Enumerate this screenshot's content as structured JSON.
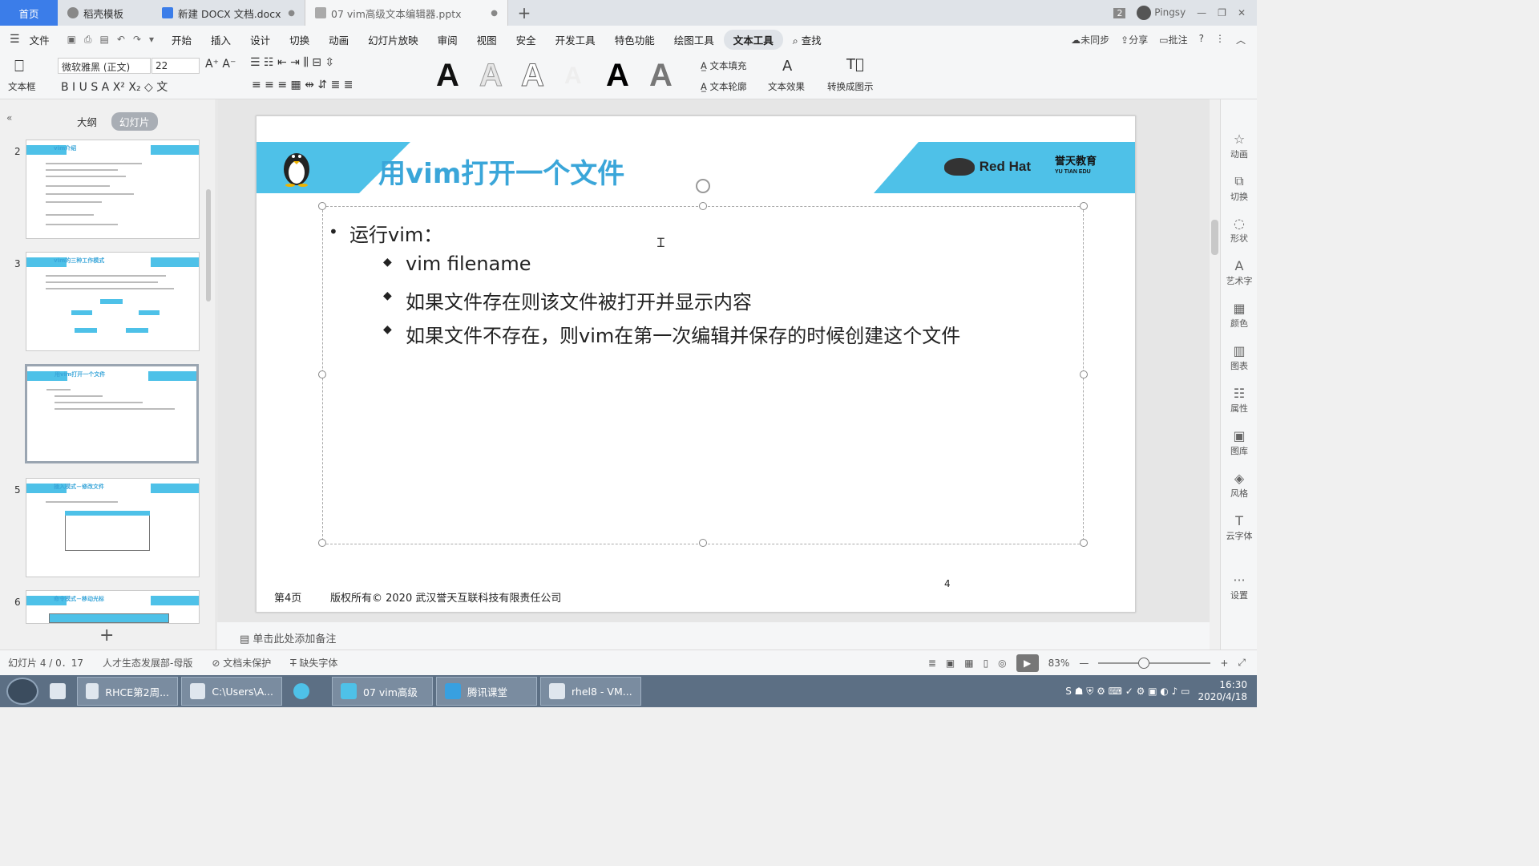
{
  "tabs": {
    "home": "首页",
    "template": "稻壳模板",
    "docx": "新建 DOCX 文档.docx",
    "pptx": "07 vim高级文本编辑器.pptx",
    "badge": "2",
    "user": "Pingsy"
  },
  "menu": {
    "file": "文件",
    "items": [
      "开始",
      "插入",
      "设计",
      "切换",
      "动画",
      "幻灯片放映",
      "审阅",
      "视图",
      "安全",
      "开发工具",
      "特色功能",
      "绘图工具"
    ],
    "active": "文本工具",
    "search": "查找",
    "sync": "未同步",
    "share": "分享",
    "comment": "批注"
  },
  "ribbon": {
    "textbox": "文本框",
    "font": "微软雅黑 (正文)",
    "size": "22",
    "fill": "文本填充",
    "outline": "文本轮廓",
    "effect": "文本效果",
    "convert": "转换成图示"
  },
  "left_panel": {
    "outline_tab": "大纲",
    "slides_tab": "幻灯片",
    "thumbs": [
      {
        "num": "2",
        "title": "vim介绍"
      },
      {
        "num": "3",
        "title": "vim的三种工作模式"
      },
      {
        "num": "",
        "title": "用vim打开一个文件"
      },
      {
        "num": "5",
        "title": "插入模式－修改文件"
      },
      {
        "num": "6",
        "title": "命令模式－移动光标"
      }
    ]
  },
  "slide": {
    "title": "用vim打开一个文件",
    "brand": "Red Hat",
    "partner": "誉天教育",
    "partner_en": "YU TIAN EDU",
    "bullet": "运行vim：",
    "sub_bullets": [
      "vim filename",
      "如果文件存在则该文件被打开并显示内容",
      "如果文件不存在，则vim在第一次编辑并保存的时候创建这个文件"
    ],
    "footer_page": "第4页",
    "footer_copyright": "版权所有© 2020 武汉誉天互联科技有限责任公司",
    "page_number": "4"
  },
  "right_panel": [
    "动画",
    "切换",
    "形状",
    "艺术字",
    "颜色",
    "图表",
    "属性",
    "图库",
    "风格",
    "云字体",
    "设置"
  ],
  "notes_placeholder": "单击此处添加备注",
  "status": {
    "slide": "幻灯片 4 / 0．17",
    "master": "人才生态发展部-母版",
    "protect": "文档未保护",
    "font_missing": "缺失字体",
    "zoom": "83%"
  },
  "taskbar": {
    "items": [
      "RHCE第2周...",
      "C:\\Users\\A...",
      "07 vim高级",
      "腾讯课堂",
      "rhel8 - VM..."
    ],
    "time": "16:30",
    "date": "2020/4/18"
  },
  "colors": {
    "accent": "#4ec1e8",
    "title": "#3aa6d9",
    "home_tab": "#3b7de9"
  }
}
